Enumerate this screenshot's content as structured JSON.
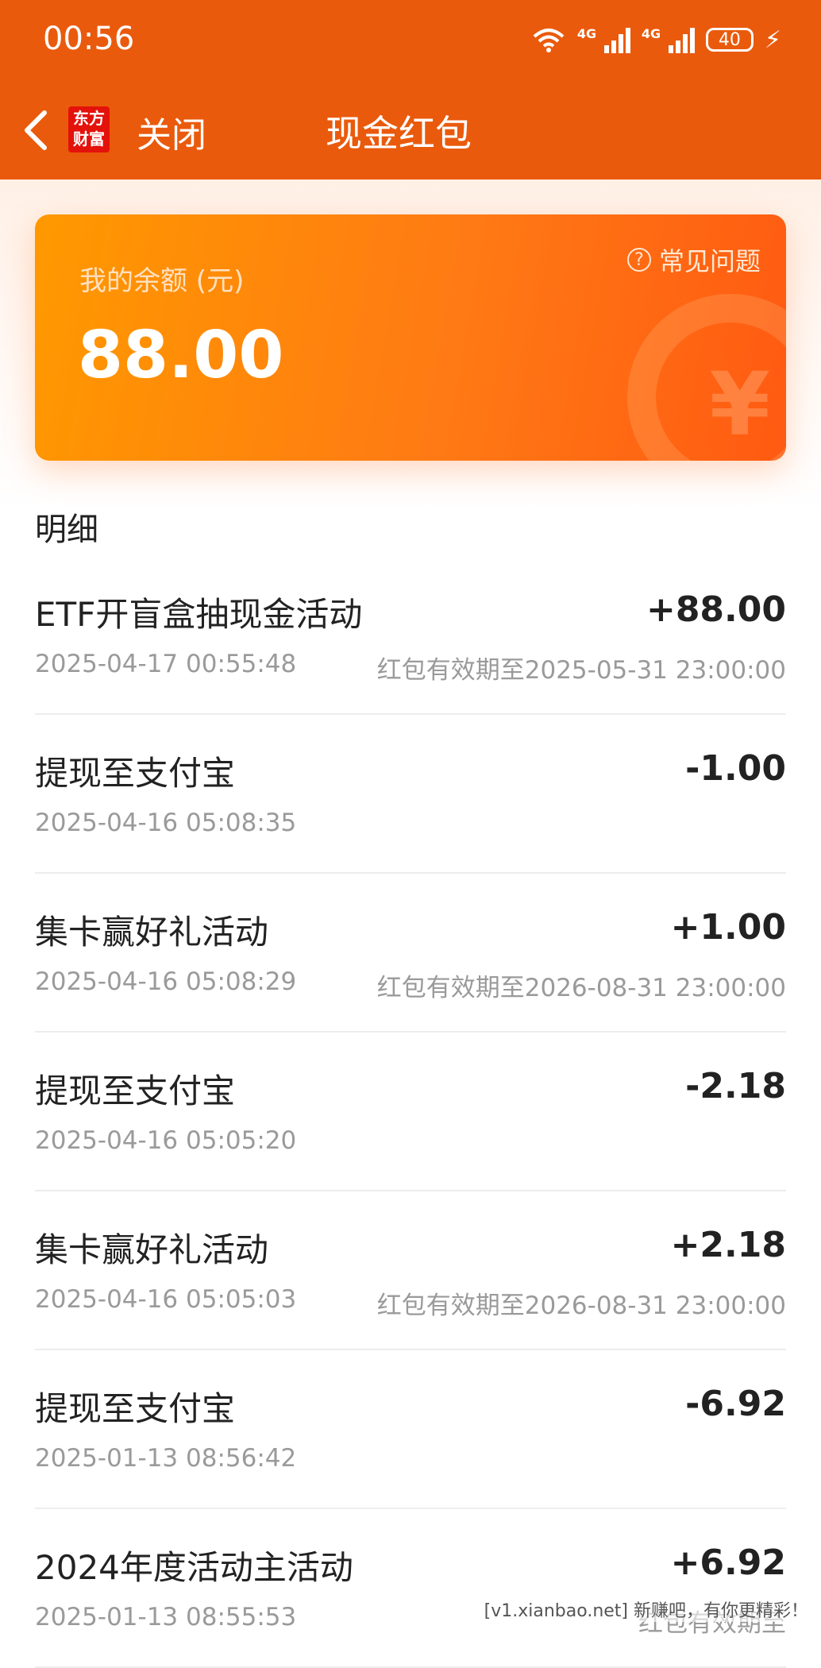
{
  "status_bar": {
    "time": "00:56",
    "signal1_tag": "4G",
    "signal2_tag": "4G",
    "battery": "40"
  },
  "nav": {
    "logo_line1": "东方",
    "logo_line2": "财富",
    "close_label": "关闭",
    "title": "现金红包"
  },
  "balance": {
    "label": "我的余额 (元)",
    "value": "88.00",
    "faq_label": "常见问题"
  },
  "details": {
    "title": "明细",
    "items": [
      {
        "title": "ETF开盲盒抽现金活动",
        "amount": "+88.00",
        "time": "2025-04-17 00:55:48",
        "expiry": "红包有效期至2025-05-31 23:00:00"
      },
      {
        "title": "提现至支付宝",
        "amount": "-1.00",
        "time": "2025-04-16 05:08:35",
        "expiry": ""
      },
      {
        "title": "集卡赢好礼活动",
        "amount": "+1.00",
        "time": "2025-04-16 05:08:29",
        "expiry": "红包有效期至2026-08-31 23:00:00"
      },
      {
        "title": "提现至支付宝",
        "amount": "-2.18",
        "time": "2025-04-16 05:05:20",
        "expiry": ""
      },
      {
        "title": "集卡赢好礼活动",
        "amount": "+2.18",
        "time": "2025-04-16 05:05:03",
        "expiry": "红包有效期至2026-08-31 23:00:00"
      },
      {
        "title": "提现至支付宝",
        "amount": "-6.92",
        "time": "2025-01-13 08:56:42",
        "expiry": ""
      },
      {
        "title": "2024年度活动主活动",
        "amount": "+6.92",
        "time": "2025-01-13 08:55:53",
        "expiry": "红包有效期至"
      }
    ]
  },
  "watermark": "[v1.xianbao.net] 新赚吧，有你更精彩！",
  "colors": {
    "header": "#ea5a0c",
    "card_start": "#ff9900",
    "card_end": "#ff5a12"
  }
}
